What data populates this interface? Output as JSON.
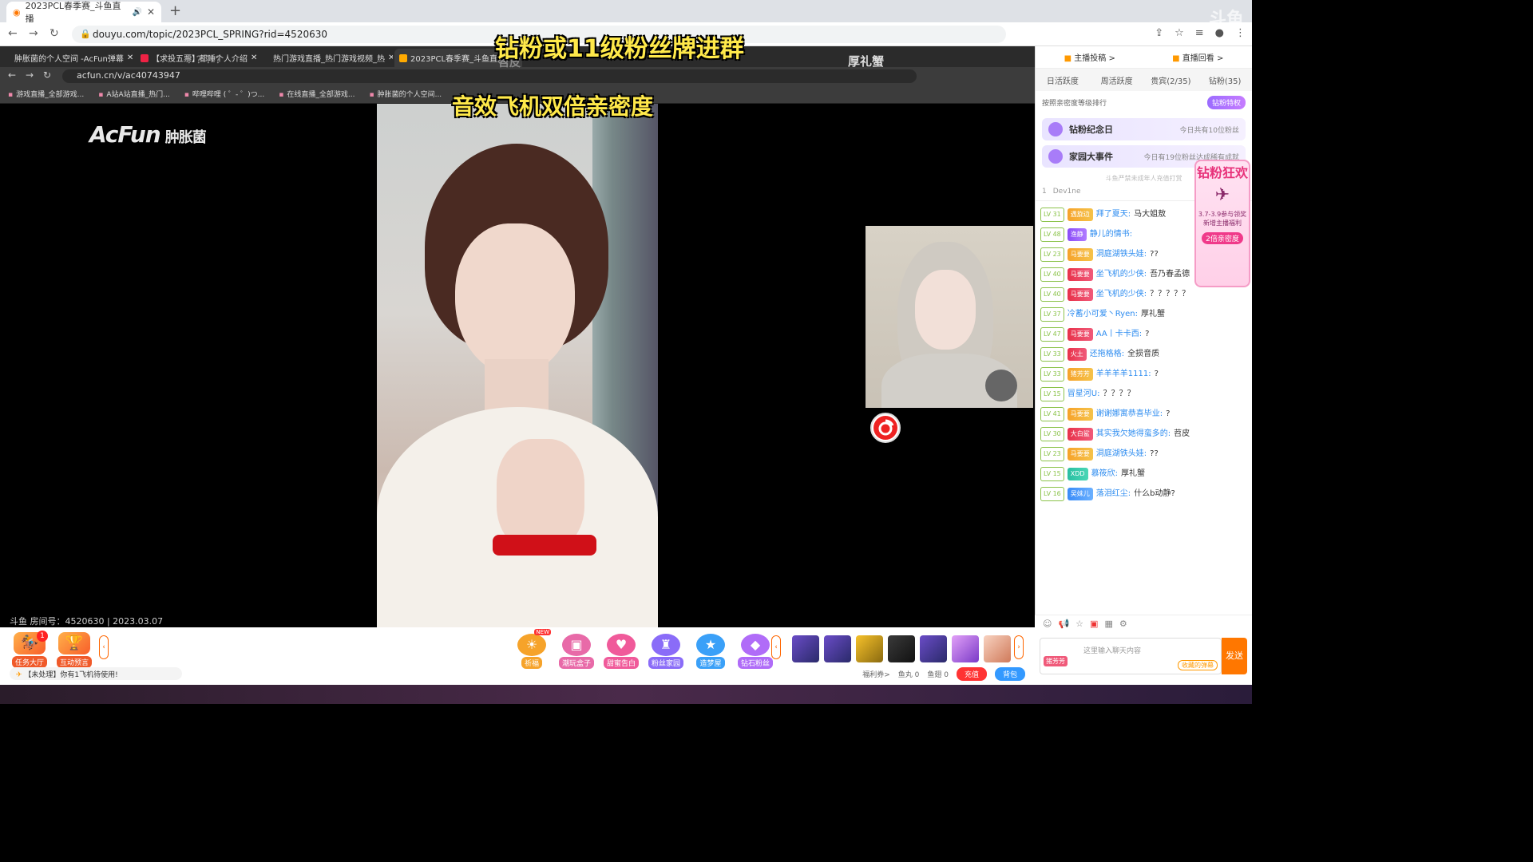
{
  "outer_browser": {
    "tab_title": "2023PCL春季赛_斗鱼直播",
    "url": "douyu.com/topic/2023PCL_SPRING?rid=4520630"
  },
  "inner_browser": {
    "tabs": [
      "肿胀菌的个人空间 -AcFun弹幕",
      "【求投五票】都睡个人介绍",
      "热门游戏直播_热门游戏视频_热",
      "2023PCL春季赛_斗鱼直播"
    ],
    "url": "acfun.cn/v/ac40743947",
    "bookmarks": [
      "游戏直播_全部游戏...",
      "A站A站直播_热门...",
      "哔哩哔哩 ( ゜- ゜)つ...",
      "在线直播_全部游戏...",
      "肿胀菌的个人空间..."
    ]
  },
  "captions": {
    "line1": "钻粉或11级粉丝牌进群",
    "line2": "音效飞机双倍亲密度",
    "ghost_left": "苕皮",
    "ghost_right": "厚礼蟹",
    "ghost_q": "？？？？"
  },
  "video": {
    "watermark_brand": "AcFun",
    "watermark_name": "肿胀菌",
    "room_info": "斗鱼 房间号：4520630 | 2023.03.07"
  },
  "bottom_bar": {
    "tools": [
      {
        "label": "任务大厅",
        "icon": "chest-icon",
        "badge": "1"
      },
      {
        "label": "互动预言",
        "icon": "trophy-icon"
      }
    ],
    "gifts": [
      {
        "label": "祈福",
        "color": "#f6a32a",
        "new": "NEW"
      },
      {
        "label": "潮玩盒子",
        "color": "#e86aa8"
      },
      {
        "label": "甜蜜告白",
        "color": "#f05a9a"
      },
      {
        "label": "粉丝家园",
        "color": "#8a6cf8"
      },
      {
        "label": "造梦屋",
        "color": "#3aa0f8"
      },
      {
        "label": "钻石粉丝",
        "color": "#b06cf8"
      }
    ],
    "notice": "【未处理】你有1飞机待使用!",
    "wallet": {
      "coupon": "福利券>",
      "fish_balls": "鱼丸 0",
      "fish_wings": "鱼翅 0",
      "charge_label": "充值",
      "bag_label": "背包"
    }
  },
  "right_panel": {
    "top_links": [
      "主播投稿 >",
      "直播回看 >"
    ],
    "rank_tabs": [
      "日活跃度",
      "周活跃度",
      "贵宾(2/35)",
      "钻粉(35)"
    ],
    "rank_hint": "按照亲密度等级排行",
    "vip_button": "钻粉特权",
    "cards": [
      {
        "title": "钻粉纪念日",
        "sub": "今日共有10位粉丝"
      },
      {
        "title": "家园大事件",
        "sub": "今日有19位粉丝达成稀有成就"
      }
    ],
    "warning": "斗鱼严禁未成年人充值打赏",
    "top_user": {
      "rank": "1",
      "name": "Dev1ne"
    },
    "messages": [
      {
        "lv": "LV 31",
        "fan": "遇旋边",
        "fan_style": "",
        "name": "拜了夏天:",
        "text": "马大姐敖"
      },
      {
        "lv": "LV 48",
        "fan": "渔静",
        "fan_style": "purple",
        "name": "静儿的情书:",
        "text": ""
      },
      {
        "lv": "LV 23",
        "fan": "马要要",
        "fan_style": "",
        "name": "洞庭湖铁头娃:",
        "text": "??"
      },
      {
        "lv": "LV 40",
        "fan": "马要要",
        "fan_style": "red",
        "name": "坐飞机的少侠:",
        "text": "吾乃春孟德"
      },
      {
        "lv": "LV 40",
        "fan": "马要要",
        "fan_style": "red",
        "name": "坐飞机的少侠:",
        "text": "？？？？？"
      },
      {
        "lv": "LV 37",
        "fan": "",
        "fan_style": "",
        "name": "冷蓄小可爱丶Ryen:",
        "text": "厚礼蟹"
      },
      {
        "lv": "LV 47",
        "fan": "马要要",
        "fan_style": "red",
        "name": "AA丨卡卡西:",
        "text": "?"
      },
      {
        "lv": "LV 33",
        "fan": "火土",
        "fan_style": "red",
        "name": "还拖格格:",
        "text": "全损音质"
      },
      {
        "lv": "LV 33",
        "fan": "猪芳芳",
        "fan_style": "",
        "name": "羊羊羊羊1111:",
        "text": "?"
      },
      {
        "lv": "LV 15",
        "fan": "",
        "fan_style": "",
        "name": "冒星河U:",
        "text": "？？？？"
      },
      {
        "lv": "LV 41",
        "fan": "马要要",
        "fan_style": "",
        "name": "谢谢娜寓恭喜毕业:",
        "text": "?"
      },
      {
        "lv": "LV 30",
        "fan": "大白鲨",
        "fan_style": "red",
        "name": "其实我欠她得蛮多的:",
        "text": "苕皮"
      },
      {
        "lv": "LV 23",
        "fan": "马要要",
        "fan_style": "",
        "name": "洞庭湖铁头娃:",
        "text": "??"
      },
      {
        "lv": "LV 15",
        "fan": "XDD",
        "fan_style": "teal",
        "name": "慕筱欣:",
        "text": "厚礼蟹"
      },
      {
        "lv": "LV 16",
        "fan": "吴妹儿",
        "fan_style": "blue",
        "name": "落泪红尘:",
        "text": "什么b动静?"
      }
    ],
    "promo": {
      "big": "钻粉狂欢",
      "line1": "3.7-3.9参与领奖",
      "line2": "新增主播福利",
      "pill": "2倍亲密度"
    },
    "input": {
      "placeholder": "这里输入聊天内容",
      "fan_badge": "猪芳芳",
      "collect": "收藏的弹幕",
      "send": "发送"
    }
  }
}
